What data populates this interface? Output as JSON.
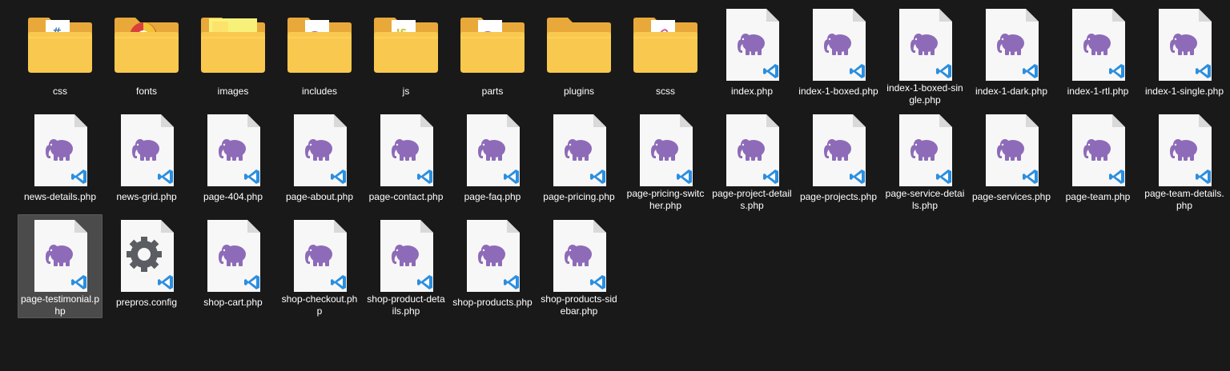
{
  "items": [
    {
      "label": "css",
      "type": "folder",
      "preview": "css"
    },
    {
      "label": "fonts",
      "type": "folder",
      "preview": "chrome"
    },
    {
      "label": "images",
      "type": "folder",
      "preview": "images"
    },
    {
      "label": "includes",
      "type": "folder",
      "preview": "php"
    },
    {
      "label": "js",
      "type": "folder",
      "preview": "js"
    },
    {
      "label": "parts",
      "type": "folder",
      "preview": "php"
    },
    {
      "label": "plugins",
      "type": "folder",
      "preview": "none"
    },
    {
      "label": "scss",
      "type": "folder",
      "preview": "sass"
    },
    {
      "label": "index.php",
      "type": "php"
    },
    {
      "label": "index-1-boxed.php",
      "type": "php"
    },
    {
      "label": "index-1-boxed-single.php",
      "type": "php"
    },
    {
      "label": "index-1-dark.php",
      "type": "php"
    },
    {
      "label": "index-1-rtl.php",
      "type": "php"
    },
    {
      "label": "index-1-single.php",
      "type": "php"
    },
    {
      "label": "news-details.php",
      "type": "php"
    },
    {
      "label": "news-grid.php",
      "type": "php"
    },
    {
      "label": "page-404.php",
      "type": "php"
    },
    {
      "label": "page-about.php",
      "type": "php"
    },
    {
      "label": "page-contact.php",
      "type": "php"
    },
    {
      "label": "page-faq.php",
      "type": "php"
    },
    {
      "label": "page-pricing.php",
      "type": "php"
    },
    {
      "label": "page-pricing-switcher.php",
      "type": "php"
    },
    {
      "label": "page-project-details.php",
      "type": "php"
    },
    {
      "label": "page-projects.php",
      "type": "php"
    },
    {
      "label": "page-service-details.php",
      "type": "php"
    },
    {
      "label": "page-services.php",
      "type": "php"
    },
    {
      "label": "page-team.php",
      "type": "php"
    },
    {
      "label": "page-team-details.php",
      "type": "php"
    },
    {
      "label": "page-testimonial.php",
      "type": "php",
      "selected": true
    },
    {
      "label": "prepros.config",
      "type": "config"
    },
    {
      "label": "shop-cart.php",
      "type": "php"
    },
    {
      "label": "shop-checkout.php",
      "type": "php"
    },
    {
      "label": "shop-product-details.php",
      "type": "php"
    },
    {
      "label": "shop-products.php",
      "type": "php"
    },
    {
      "label": "shop-products-sidebar.php",
      "type": "php"
    }
  ],
  "colors": {
    "background": "#191919",
    "folder_back": "#e8a93a",
    "folder_front": "#f9c94f",
    "php_elephant": "#8e6bb8",
    "vscode_blue": "#2b8fe0",
    "selection": "#4b4b4b"
  },
  "icons": {
    "folder": "folder-icon",
    "php": "php-file-icon",
    "config": "gear-file-icon"
  }
}
